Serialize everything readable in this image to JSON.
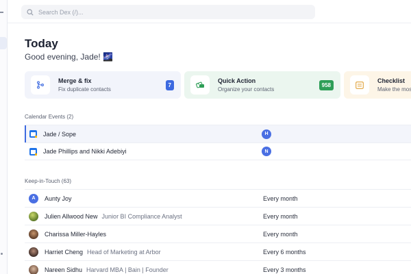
{
  "search": {
    "placeholder": "Search Dex (/)..."
  },
  "page": {
    "title": "Today",
    "greeting": "Good evening, Jade! 🌌"
  },
  "cards": [
    {
      "title": "Merge & fix",
      "subtitle": "Fix duplicate contacts",
      "badge": "7",
      "badge_color": "#3d6ae0",
      "icon": "merge-icon"
    },
    {
      "title": "Quick Action",
      "subtitle": "Organize your contacts",
      "badge": "958",
      "badge_color": "#2e9e57",
      "icon": "tag-icon"
    },
    {
      "title": "Checklist",
      "subtitle": "Make the most",
      "icon": "checklist-icon"
    }
  ],
  "calendar": {
    "header": "Calendar Events (2)",
    "events": [
      {
        "name": "Jade / Sope",
        "attendee": "H"
      },
      {
        "name": "Jade Phillips and Nikki Adebiyi",
        "attendee": "N"
      }
    ]
  },
  "keep": {
    "header": "Keep-in-Touch (63)",
    "contacts": [
      {
        "name": "Aunty Joy",
        "title": "",
        "frequency": "Every month",
        "initial": "A"
      },
      {
        "name": "Julien Allwood New",
        "title": "Junior BI Compliance Analyst",
        "frequency": "Every month"
      },
      {
        "name": "Charissa Miller-Hayles",
        "title": "",
        "frequency": "Every month"
      },
      {
        "name": "Harriet Cheng",
        "title": "Head of Marketing at Arbor",
        "frequency": "Every 6 months"
      },
      {
        "name": "Nareen Sidhu",
        "title": "Harvard MBA | Bain | Founder",
        "frequency": "Every 3 months"
      }
    ]
  }
}
